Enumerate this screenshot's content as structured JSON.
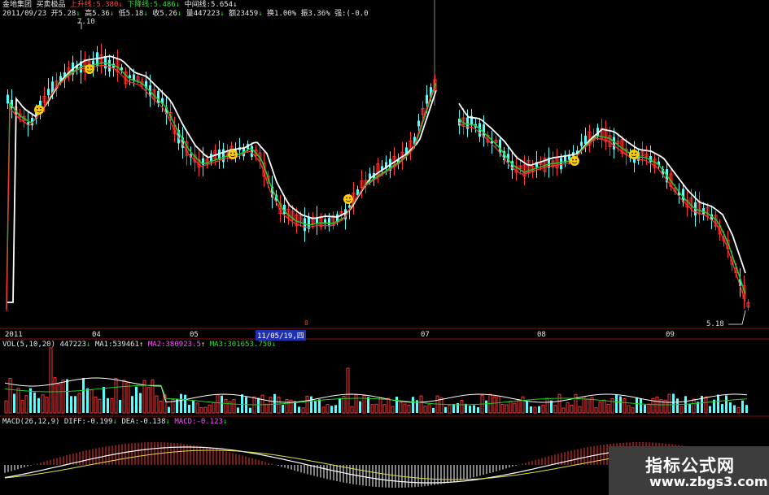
{
  "header": {
    "stock_name": "金地集团",
    "indicator_name": "买卖极品",
    "upper_line": "上升线:5.380",
    "lower_line": "下降线:5.486",
    "mid_line": "中间线:5.654",
    "arrow_down": "↓",
    "date": "2011/09/23",
    "open": "开5.28",
    "high": "高5.36",
    "low": "低5.18",
    "close": "收5.26",
    "volume": "量447223",
    "amount": "额23459",
    "turnover": "换1.00%",
    "amplitude": "振3.36%",
    "strength": "强:(-0.0"
  },
  "price_marks": {
    "max_label": "7.10",
    "min_label": "5.18"
  },
  "date_axis": {
    "labels": [
      "2011",
      "04",
      "05",
      "07",
      "08",
      "09"
    ],
    "selected_date": "11/05/19,四"
  },
  "volume_panel": {
    "title": "VOL(5,10,20)",
    "vol": "447223",
    "ma1": "MA1:539461",
    "ma2": "MA2:380923.5",
    "ma3": "MA3:301653.750",
    "up_arrow": "↑"
  },
  "macd_panel": {
    "title": "MACD(26,12,9)",
    "diff": "DIFF:-0.199",
    "dea": "DEA:-0.138",
    "macd": "MACD:-0.123"
  },
  "watermark": {
    "title": "指标公式网",
    "url": "www.zbgs3.com"
  },
  "colors": {
    "up": "#ff3333",
    "down": "#55ffff",
    "ma_white": "#ffffff",
    "ma_green": "#22cc22",
    "ma_red": "#ff3333",
    "grid": "#8a1010"
  }
}
